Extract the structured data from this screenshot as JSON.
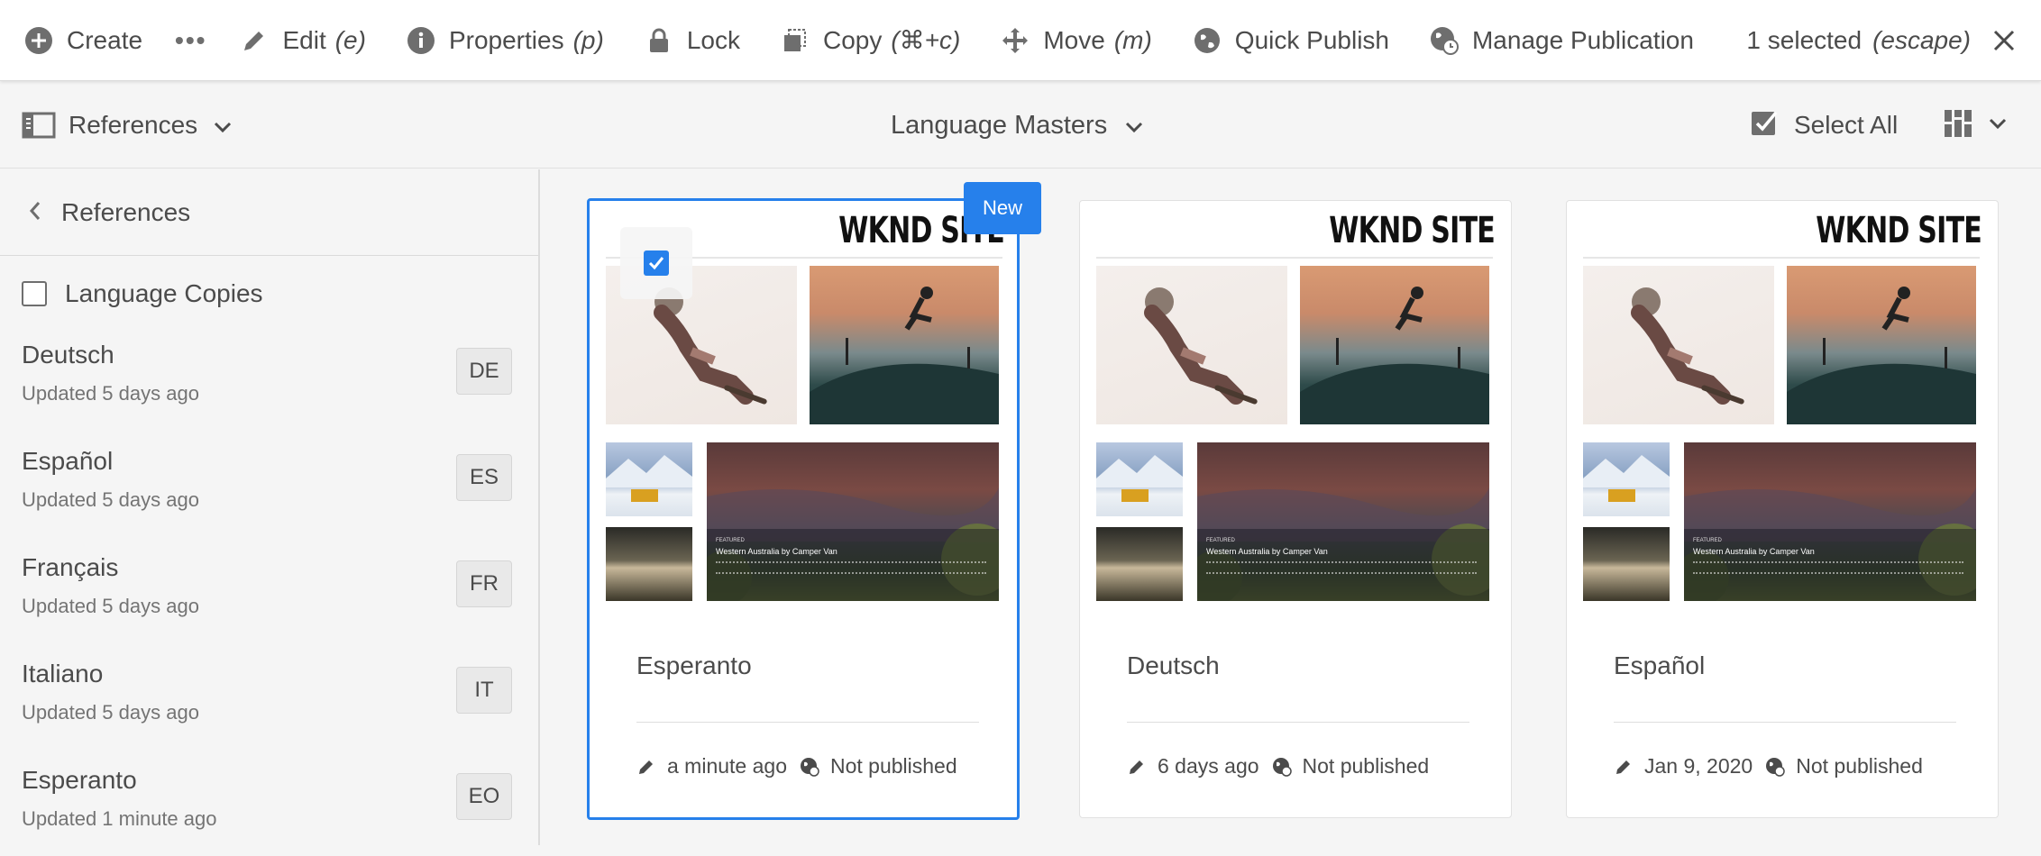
{
  "actionbar": {
    "create": "Create",
    "more": "•••",
    "edit": "Edit",
    "edit_sc": "(e)",
    "properties": "Properties",
    "properties_sc": "(p)",
    "lock": "Lock",
    "copy": "Copy",
    "copy_sc": "(⌘+c)",
    "move": "Move",
    "move_sc": "(m)",
    "quick_publish": "Quick Publish",
    "manage_publication": "Manage Publication",
    "selected": "1 selected",
    "selected_sc": "(escape)"
  },
  "subbar": {
    "rail_label": "References",
    "title": "Language Masters",
    "select_all": "Select All"
  },
  "rail": {
    "back_label": "References",
    "language_copies": "Language Copies",
    "languages": [
      {
        "name": "Deutsch",
        "updated": "Updated 5 days ago",
        "code": "DE"
      },
      {
        "name": "Español",
        "updated": "Updated 5 days ago",
        "code": "ES"
      },
      {
        "name": "Français",
        "updated": "Updated 5 days ago",
        "code": "FR"
      },
      {
        "name": "Italiano",
        "updated": "Updated 5 days ago",
        "code": "IT"
      },
      {
        "name": "Esperanto",
        "updated": "Updated 1 minute ago",
        "code": "EO"
      }
    ]
  },
  "cards": [
    {
      "title": "Esperanto",
      "modified": "a minute ago",
      "status": "Not published",
      "brand": "WKND SITE",
      "selected": true
    },
    {
      "title": "Deutsch",
      "modified": "6 days ago",
      "status": "Not published",
      "brand": "WKND SITE",
      "selected": false
    },
    {
      "title": "Español",
      "modified": "Jan 9, 2020",
      "status": "Not published",
      "brand": "WKND SITE",
      "selected": false
    }
  ],
  "thumb_text": {
    "featured": "FEATURED",
    "headline": "Western Australia by Camper Van"
  },
  "new_badge": "New",
  "colors": {
    "accent": "#2680eb",
    "text": "#4b4b4b",
    "muted": "#747474",
    "background": "#f5f5f5"
  }
}
